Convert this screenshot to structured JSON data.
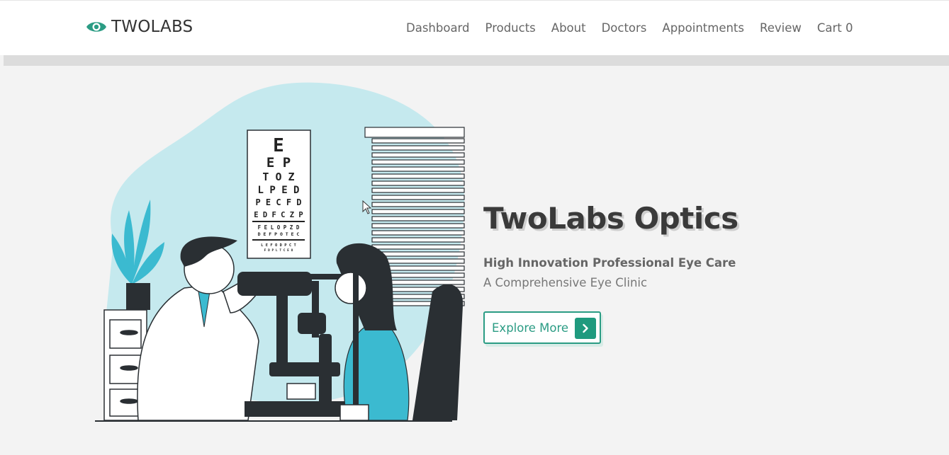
{
  "brand": {
    "name": "TWOLABS",
    "icon": "eye-icon",
    "accent_color": "#2b9c84"
  },
  "nav": {
    "items": [
      {
        "label": "Dashboard"
      },
      {
        "label": "Products"
      },
      {
        "label": "About"
      },
      {
        "label": "Doctors"
      },
      {
        "label": "Appointments"
      },
      {
        "label": "Review"
      },
      {
        "label": "Cart 0"
      }
    ]
  },
  "hero": {
    "title": "TwoLabs Optics",
    "subtitle": "High Innovation Professional Eye Care",
    "tagline": "A Comprehensive Eye Clinic",
    "cta_label": "Explore More",
    "cta_icon": "chevron-right-icon",
    "illustration": "eye-exam-illustration",
    "eye_chart_rows": [
      "E",
      "E P",
      "T O Z",
      "L P E D",
      "P E C F D",
      "E D F C Z P",
      "F E L O P Z D",
      "D E F P O T E C",
      "L E F O D P C T",
      "F D P L T C E O"
    ]
  }
}
